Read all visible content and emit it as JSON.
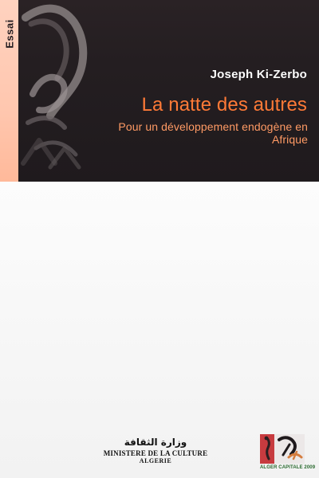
{
  "cover": {
    "series_tab": "Essai",
    "author": "Joseph Ki-Zerbo",
    "title": "La natte des autres",
    "subtitle": "Pour un développement endogène en Afrique"
  },
  "footer": {
    "ministry_arabic": "وزارة الثقافة",
    "ministry_french": "MINISTERE DE LA CULTURE",
    "ministry_country": "ALGERIE",
    "logo_caption": "ALGER CAPITALE 2009"
  },
  "colors": {
    "top_band": "#241e21",
    "side_tab": "#ffc7af",
    "title": "#ff7a37",
    "subtitle": "#ff9a64",
    "author": "#ffffff",
    "background": "#fbfbfb"
  },
  "icons": {
    "artwork": "abstract-figure-icon",
    "logo": "festival-logo-icon"
  }
}
